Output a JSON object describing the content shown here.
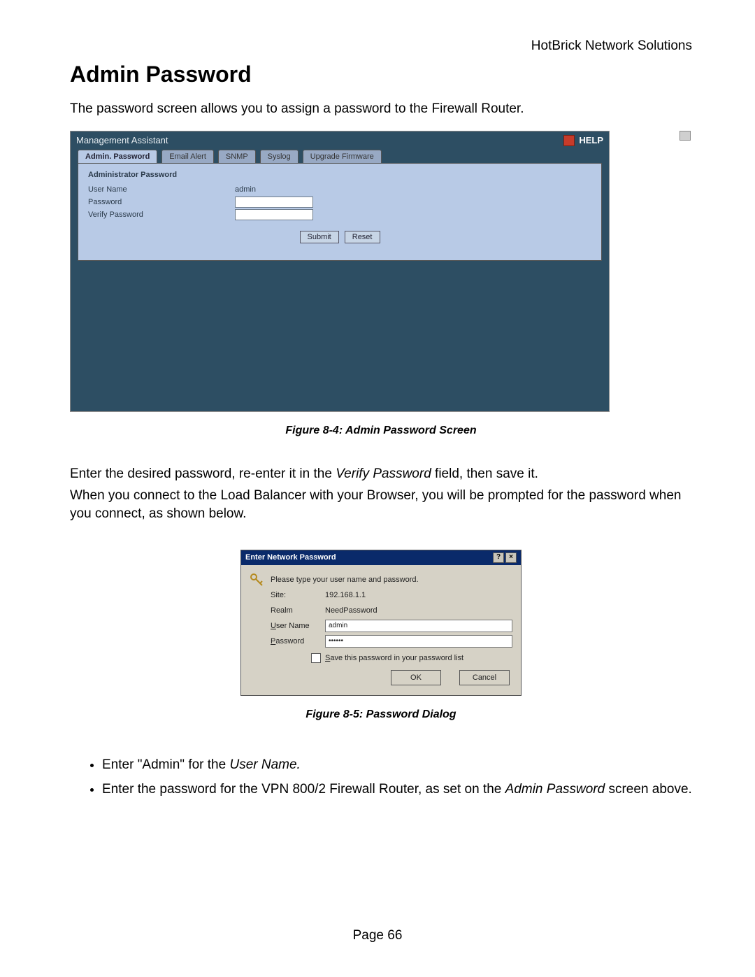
{
  "header": {
    "company": "HotBrick Network Solutions"
  },
  "title": "Admin Password",
  "intro": "The password screen allows you to assign a password to the Firewall Router.",
  "fig1": {
    "window_title": "Management Assistant",
    "help": "HELP",
    "tabs": [
      "Admin. Password",
      "Email Alert",
      "SNMP",
      "Syslog",
      "Upgrade Firmware"
    ],
    "panel_title": "Administrator Password",
    "rows": {
      "user_label": "User Name",
      "user_value": "admin",
      "password_label": "Password",
      "verify_label": "Verify Password"
    },
    "buttons": {
      "submit": "Submit",
      "reset": "Reset"
    },
    "caption": "Figure 8-4: Admin Password Screen"
  },
  "para1_a": "Enter the desired password, re-enter it in the ",
  "para1_b": "Verify Password",
  "para1_c": " field, then save it.",
  "para2": "When you connect to the Load Balancer with your Browser, you will be prompted for the password when you connect, as shown below.",
  "fig2": {
    "title": "Enter Network Password",
    "prompt": "Please type your user name and password.",
    "site_label": "Site:",
    "site_value": "192.168.1.1",
    "realm_label": "Realm",
    "realm_value": "NeedPassword",
    "user_label": "User Name",
    "user_value": "admin",
    "password_label": "Password",
    "password_value": "••••••",
    "save_label": "Save this password in your password list",
    "ok": "OK",
    "cancel": "Cancel",
    "question": "?",
    "close": "×",
    "caption": "Figure 8-5: Password Dialog"
  },
  "bullets": {
    "b1_a": "Enter \"Admin\" for the ",
    "b1_b": "User Name.",
    "b2_a": "Enter the password for the VPN 800/2 Firewall Router, as set on the ",
    "b2_b": "Admin Password",
    "b2_c": " screen above."
  },
  "footer": "Page 66"
}
